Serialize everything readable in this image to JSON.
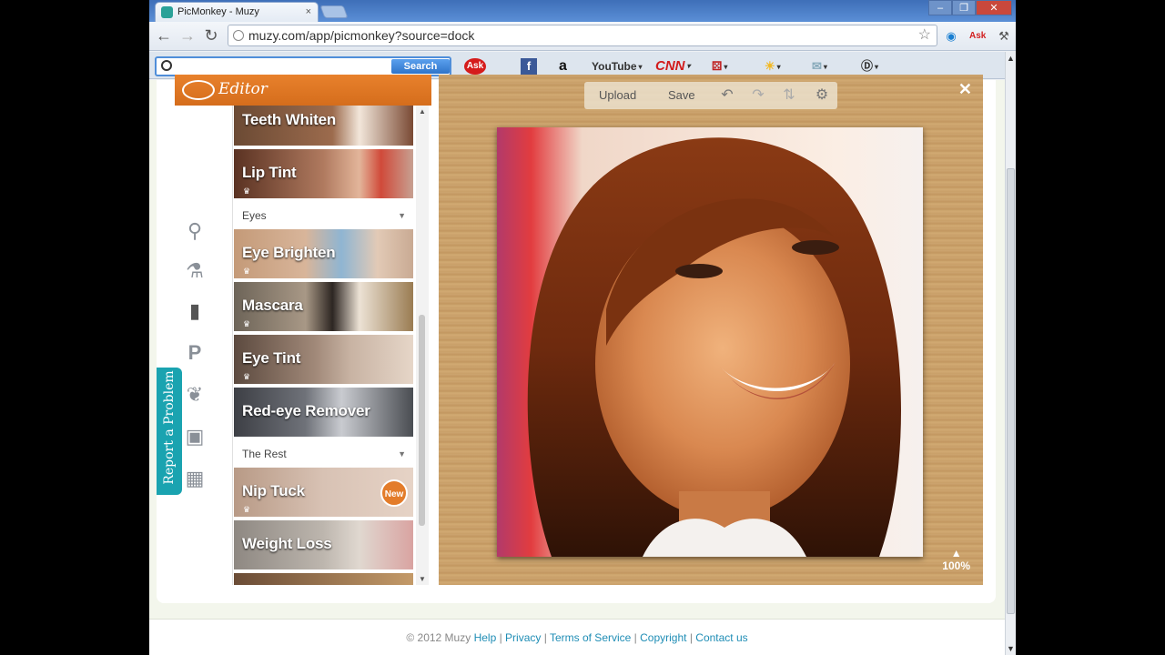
{
  "window": {
    "tab_title": "PicMonkey - Muzy",
    "tab_close": "×",
    "controls": [
      "–",
      "❐",
      "✕"
    ]
  },
  "toolbar": {
    "url": "muzy.com/app/picmonkey?source=dock",
    "back": "←",
    "forward": "→",
    "reload": "↻"
  },
  "searchbar": {
    "search_button": "Search",
    "items": [
      "Ask",
      "f",
      "a",
      "YouTube",
      "CNN",
      "",
      "",
      "",
      "D"
    ]
  },
  "editor": {
    "title": "Editor"
  },
  "features": [
    {
      "label": "Teeth Whiten"
    },
    {
      "label": "Lip Tint"
    },
    {
      "label": "Eye Brighten"
    },
    {
      "label": "Mascara"
    },
    {
      "label": "Eye Tint"
    },
    {
      "label": "Red-eye Remover"
    },
    {
      "label": "Nip Tuck",
      "badge": "New"
    },
    {
      "label": "Weight Loss"
    }
  ],
  "sections": {
    "eyes": "Eyes",
    "rest": "The Rest"
  },
  "canvas_tools": {
    "upload": "Upload",
    "save": "Save"
  },
  "zoom": "100%",
  "report_tab": "Report a Problem",
  "footer": {
    "copyright": "© 2012 Muzy",
    "links": [
      "Help",
      "Privacy",
      "Terms of Service",
      "Copyright",
      "Contact us"
    ]
  },
  "colors": {
    "editor_orange": "#d56d1c",
    "teal": "#1aa3b0",
    "link_blue": "#1f8db5"
  }
}
